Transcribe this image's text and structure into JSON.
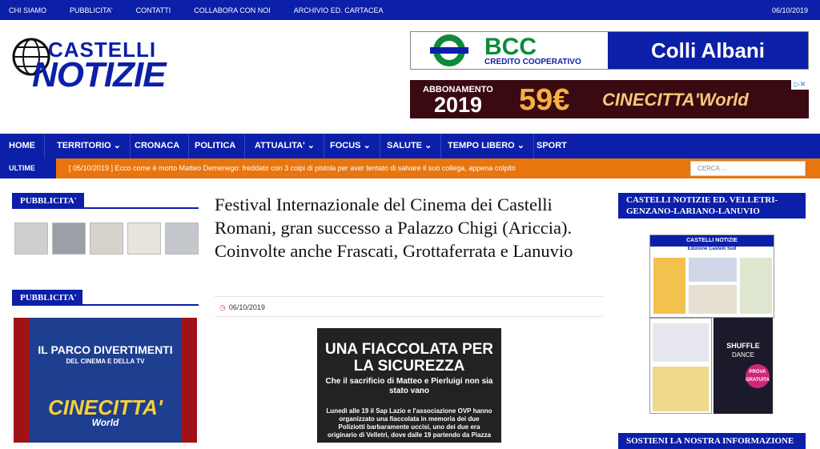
{
  "topbar": {
    "links": [
      "CHI SIAMO",
      "PUBBLICITA'",
      "CONTATTI",
      "COLLABORA CON NOI",
      "ARCHIVIO ED. CARTACEA"
    ],
    "date": "06/10/2019"
  },
  "logo": {
    "line1": "CASTELLI",
    "line2": "NOTIZIE"
  },
  "ad_bcc": {
    "name": "BCC",
    "subtitle": "CREDITO COOPERATIVO",
    "region": "Colli Albani"
  },
  "ad_cinecitta": {
    "label": "ABBONAMENTO",
    "year": "2019",
    "price": "59€",
    "brand": "CINECITTA'World"
  },
  "nav": {
    "items": [
      "HOME",
      "TERRITORIO",
      "CRONACA",
      "POLITICA",
      "ATTUALITA'",
      "FOCUS",
      "SALUTE",
      "TEMPO LIBERO",
      "SPORT"
    ],
    "dropdowns": [
      false,
      true,
      false,
      false,
      true,
      true,
      true,
      true,
      false
    ]
  },
  "ticker": {
    "label": "ULTIME",
    "text": "[ 05/10/2019 ]  Ecco come è morto Matteo Demenego: freddato con 3 colpi di pistola per aver tentato di salvare il suo collega, appena colpito",
    "search_placeholder": "CERCA ..."
  },
  "left_sidebar": {
    "widget1_title": "PUBBLICITA'",
    "widget2_title": "PUBBLICITA'",
    "poster": {
      "line1": "IL PARCO DIVERTIMENTI",
      "line2": "DEL CINEMA E DELLA TV",
      "brand": "CINECITTA'",
      "brand2": "World"
    }
  },
  "article": {
    "title": "Festival Internazionale del Cinema dei Castelli Romani, gran successo a Palazzo Chigi (Ariccia). Coinvolte anche Frascati, Grottaferrata e Lanuvio",
    "date": "06/10/2019",
    "image": {
      "headline": "UNA FIACCOLATA PER LA SICUREZZA",
      "subhead": "Che il sacrificio di Matteo e Pierluigi non sia stato vano",
      "body": "Lunedì alle 19 il Sap Lazio e l'associazione OVP hanno organizzato una fiaccolata in memoria dei due Poliziotti barbaramente uccisi, uno dei due era originario di Velletri, dove dalle 19 partendo da Piazza"
    }
  },
  "right_sidebar": {
    "widget1_title": "CASTELLI NOTIZIE ED. VELLETRI-GENZANO-LARIANO-LANUVIO",
    "widget2_title": "SOSTIENI LA NOSTRA INFORMAZIONE",
    "papers": {
      "mast": "CASTELLI NOTIZIE",
      "edition": "Edizione Castelli Sud",
      "ad_title": "SHUFFLE",
      "ad_sub": "DANCE",
      "ad_badge": "PROVA GRATUITA"
    }
  },
  "colors": {
    "brand_blue": "#0b1fa8",
    "ticker_orange": "#e8750e"
  }
}
